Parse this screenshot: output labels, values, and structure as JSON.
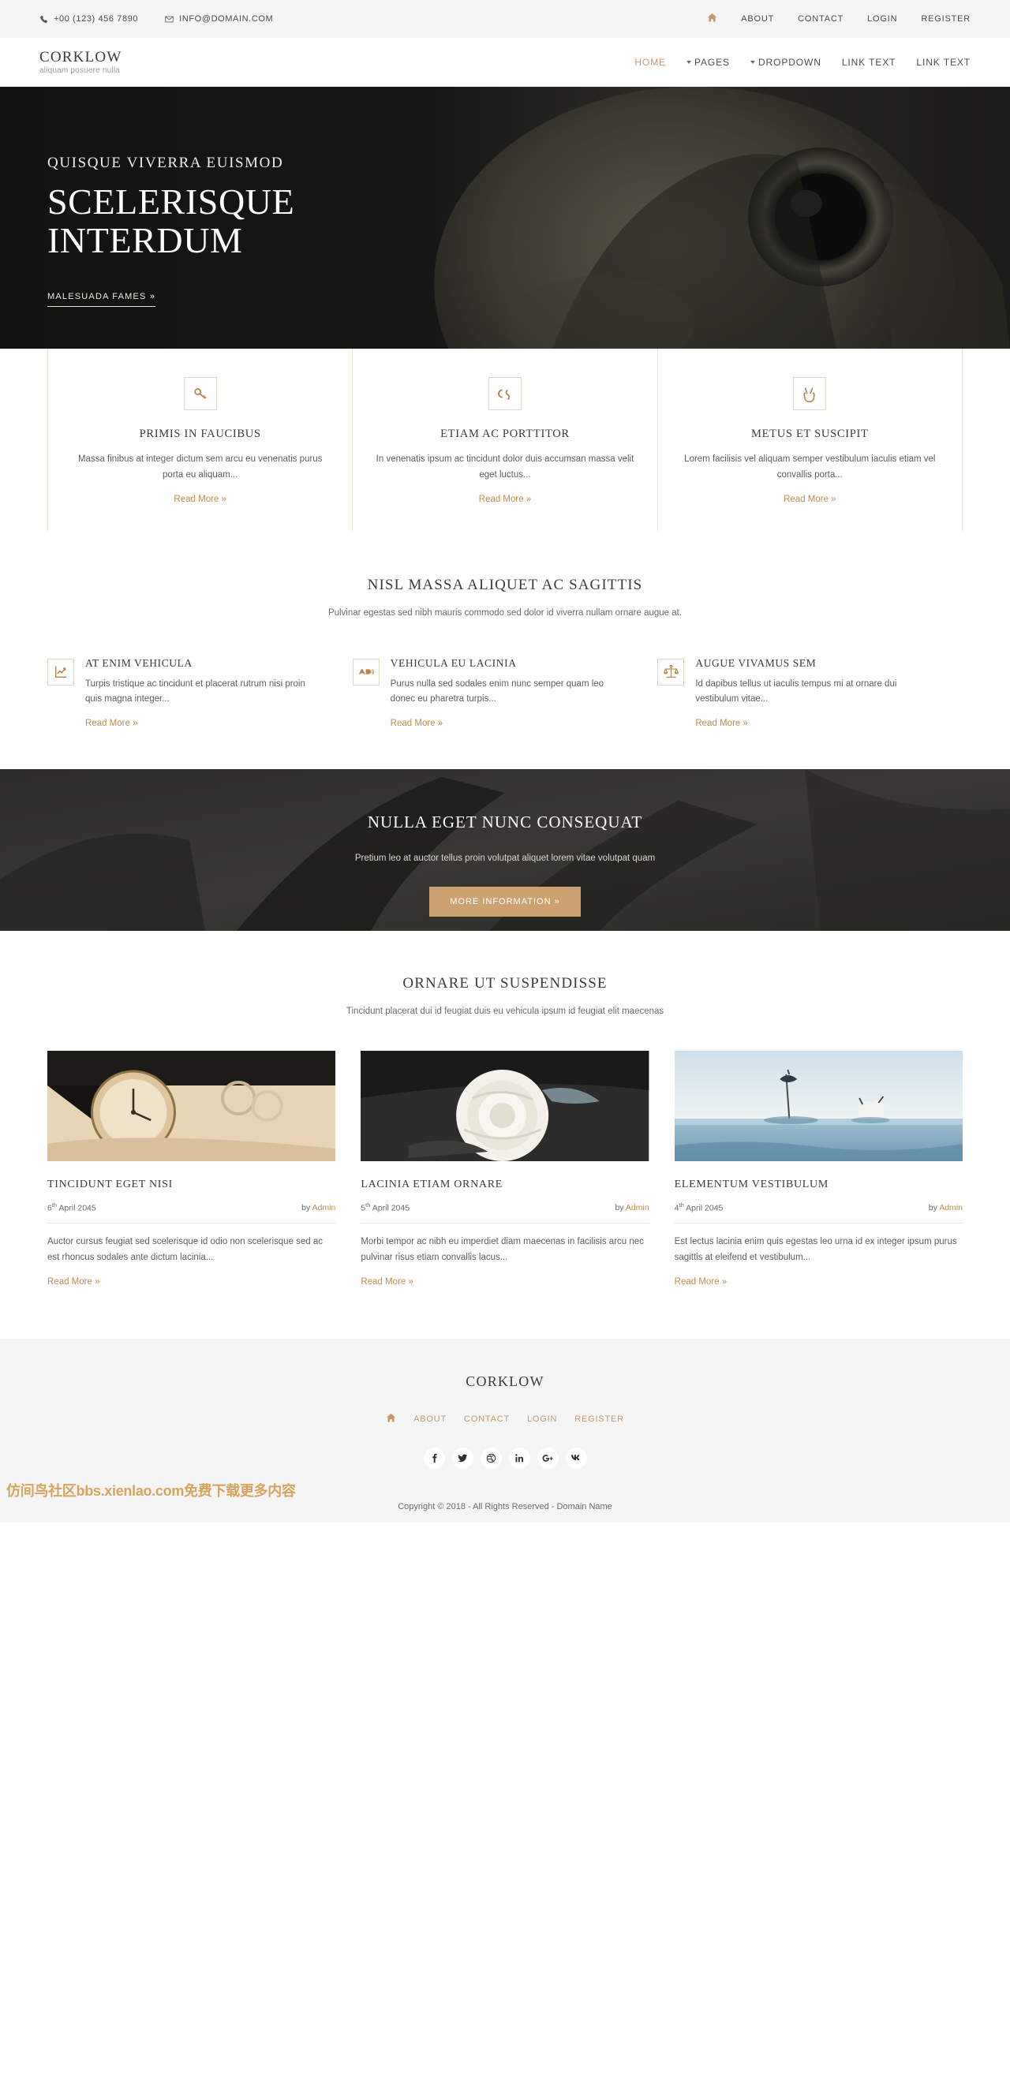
{
  "topbar": {
    "phone": "+00 (123) 456 7890",
    "email": "INFO@DOMAIN.COM",
    "links": [
      {
        "label": "ABOUT"
      },
      {
        "label": "CONTACT"
      },
      {
        "label": "LOGIN"
      },
      {
        "label": "REGISTER"
      }
    ]
  },
  "header": {
    "logo": "CORKLOW",
    "tagline": "aliquam posuere nulla",
    "nav": [
      {
        "label": "HOME",
        "active": true,
        "caret": false
      },
      {
        "label": "PAGES",
        "active": false,
        "caret": true
      },
      {
        "label": "DROPDOWN",
        "active": false,
        "caret": true
      },
      {
        "label": "LINK TEXT",
        "active": false,
        "caret": false
      },
      {
        "label": "LINK TEXT",
        "active": false,
        "caret": false
      }
    ]
  },
  "hero": {
    "eyebrow": "QUISQUE VIVERRA EUISMOD",
    "title_line1": "SCELERISQUE",
    "title_line2": "INTERDUM",
    "button": "MALESUADA FAMES »"
  },
  "features": [
    {
      "icon": "key-icon",
      "title": "PRIMIS IN FAUCIBUS",
      "text": "Massa finibus at integer dictum sem arcu eu venenatis purus porta eu aliquam...",
      "link": "Read More »"
    },
    {
      "icon": "creative-commons-sa-icon",
      "title": "ETIAM AC PORTTITOR",
      "text": "In venenatis ipsum ac tincidunt dolor duis accumsan massa velit eget luctus...",
      "link": "Read More »"
    },
    {
      "icon": "peace-hand-icon",
      "title": "METUS ET SUSCIPIT",
      "text": "Lorem facilisis vel aliquam semper vestibulum iaculis etiam vel convallis porta...",
      "link": "Read More »"
    }
  ],
  "services": {
    "title": "NISL MASSA ALIQUET AC SAGITTIS",
    "subtitle": "Pulvinar egestas sed nibh mauris commodo sed dolor id viverra nullam ornare augue at.",
    "items": [
      {
        "icon": "chart-line-icon",
        "title": "AT ENIM VEHICULA",
        "text": "Turpis tristique ac tincidunt et placerat rutrum nisi proin quis magna integer...",
        "link": "Read More »"
      },
      {
        "icon": "audio-description-icon",
        "title": "VEHICULA EU LACINIA",
        "text": "Purus nulla sed sodales enim nunc semper quam leo donec eu pharetra turpis...",
        "link": "Read More »"
      },
      {
        "icon": "balance-scale-icon",
        "title": "AUGUE VIVAMUS SEM",
        "text": "Id dapibus tellus ut iaculis tempus mi at ornare dui vestibulum vitae...",
        "link": "Read More »"
      }
    ]
  },
  "callout": {
    "title": "NULLA EGET NUNC CONSEQUAT",
    "subtitle": "Pretium leo at auctor tellus proin volutpat aliquet lorem vitae volutpat quam",
    "button": "MORE INFORMATION »"
  },
  "blog": {
    "title": "ORNARE UT SUSPENDISSE",
    "subtitle": "Tincidunt placerat dui id feugiat duis eu vehicula ipsum id feugiat elit maecenas",
    "posts": [
      {
        "title": "TINCIDUNT EGET NISI",
        "day": "6",
        "ord": "th",
        "date_rest": " April 2045",
        "by_label": "by ",
        "author": "Admin",
        "text": "Auctor cursus feugiat sed scelerisque id odio non scelerisque sed ac est rhoncus sodales ante dictum lacinia...",
        "link": "Read More »"
      },
      {
        "title": "LACINIA ETIAM ORNARE",
        "day": "5",
        "ord": "th",
        "date_rest": " April 2045",
        "by_label": "by ",
        "author": "Admin",
        "text": "Morbi tempor ac nibh eu imperdiet diam maecenas in facilisis arcu nec pulvinar risus etiam convallis lacus...",
        "link": "Read More »"
      },
      {
        "title": "ELEMENTUM VESTIBULUM",
        "day": "4",
        "ord": "th",
        "date_rest": " April 2045",
        "by_label": "by ",
        "author": "Admin",
        "text": "Est lectus lacinia enim quis egestas leo urna id ex integer ipsum purus sagittis at eleifend et vestibulum...",
        "link": "Read More »"
      }
    ]
  },
  "footer": {
    "logo": "CORKLOW",
    "nav": [
      {
        "label": "ABOUT"
      },
      {
        "label": "CONTACT"
      },
      {
        "label": "LOGIN"
      },
      {
        "label": "REGISTER"
      }
    ],
    "socials": [
      {
        "name": "facebook-icon",
        "glyph": "f"
      },
      {
        "name": "twitter-icon",
        "glyph": "✈"
      },
      {
        "name": "dribbble-icon",
        "glyph": "ⓓ"
      },
      {
        "name": "linkedin-icon",
        "glyph": "in"
      },
      {
        "name": "google-plus-icon",
        "glyph": "G+"
      },
      {
        "name": "vk-icon",
        "glyph": "vk"
      }
    ],
    "watermark": "仿间鸟社区bbs.xienlao.com免费下载更多内容",
    "copyright": "Copyright © 2018 - All Rights Reserved - Domain Name"
  },
  "colors": {
    "accent": "#c08b4f",
    "accent_light": "#cda273",
    "dark": "#3b3b3b",
    "topbar_bg": "#f5f5f5"
  }
}
